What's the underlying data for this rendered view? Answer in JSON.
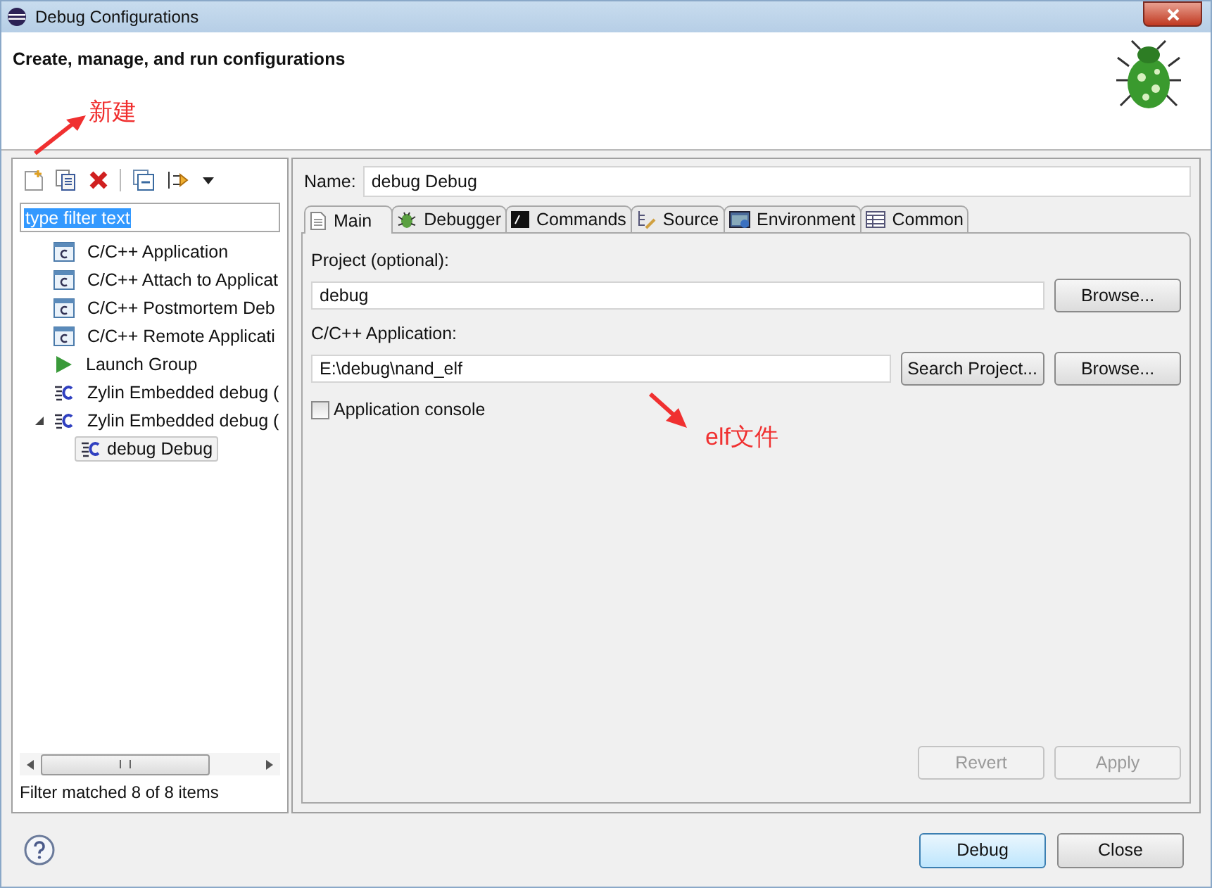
{
  "window": {
    "title": "Debug Configurations"
  },
  "header": {
    "title": "Create, manage, and run configurations"
  },
  "annotations": [
    {
      "kind": "new",
      "text": "新建"
    },
    {
      "kind": "elf",
      "text": "elf文件"
    }
  ],
  "sidebar": {
    "filter": {
      "value": "type filter text",
      "selected": true
    },
    "tree": [
      {
        "label": "C/C++ Application",
        "kind": "cpp",
        "expanded": false,
        "selected": false
      },
      {
        "label": "C/C++ Attach to Applicat",
        "kind": "cpp",
        "expanded": false,
        "selected": false
      },
      {
        "label": "C/C++ Postmortem Deb",
        "kind": "cpp",
        "expanded": false,
        "selected": false
      },
      {
        "label": "C/C++ Remote Applicati",
        "kind": "cpp",
        "expanded": false,
        "selected": false
      },
      {
        "label": "Launch Group",
        "kind": "launch",
        "expanded": false,
        "selected": false
      },
      {
        "label": "Zylin Embedded debug (",
        "kind": "zylin",
        "expanded": false,
        "selected": false
      },
      {
        "label": "Zylin Embedded debug (",
        "kind": "zylin",
        "expanded": true,
        "selected": false,
        "children": [
          {
            "label": "debug Debug",
            "kind": "zylin",
            "selected": true
          }
        ]
      }
    ],
    "status": "Filter matched 8 of 8 items"
  },
  "editor": {
    "name_label": "Name:",
    "name_value": "debug Debug",
    "tabs": [
      {
        "label": "Main",
        "kind": "main",
        "selected": true
      },
      {
        "label": "Debugger",
        "kind": "debugger",
        "selected": false
      },
      {
        "label": "Commands",
        "kind": "commands",
        "selected": false
      },
      {
        "label": "Source",
        "kind": "source",
        "selected": false
      },
      {
        "label": "Environment",
        "kind": "environment",
        "selected": false
      },
      {
        "label": "Common",
        "kind": "common",
        "selected": false
      }
    ],
    "project_label": "Project (optional):",
    "project_value": "debug",
    "project_browse": "Browse...",
    "app_label": "C/C++ Application:",
    "app_value": "E:\\debug\\nand_elf",
    "search_project": "Search Project...",
    "app_browse": "Browse...",
    "console": {
      "label": "Application console",
      "checked": false
    },
    "revert": {
      "label": "Revert",
      "disabled": true
    },
    "apply": {
      "label": "Apply",
      "disabled": true
    }
  },
  "buttons": [
    {
      "label": "Debug",
      "kind": "default"
    },
    {
      "label": "Close",
      "kind": "normal"
    }
  ]
}
